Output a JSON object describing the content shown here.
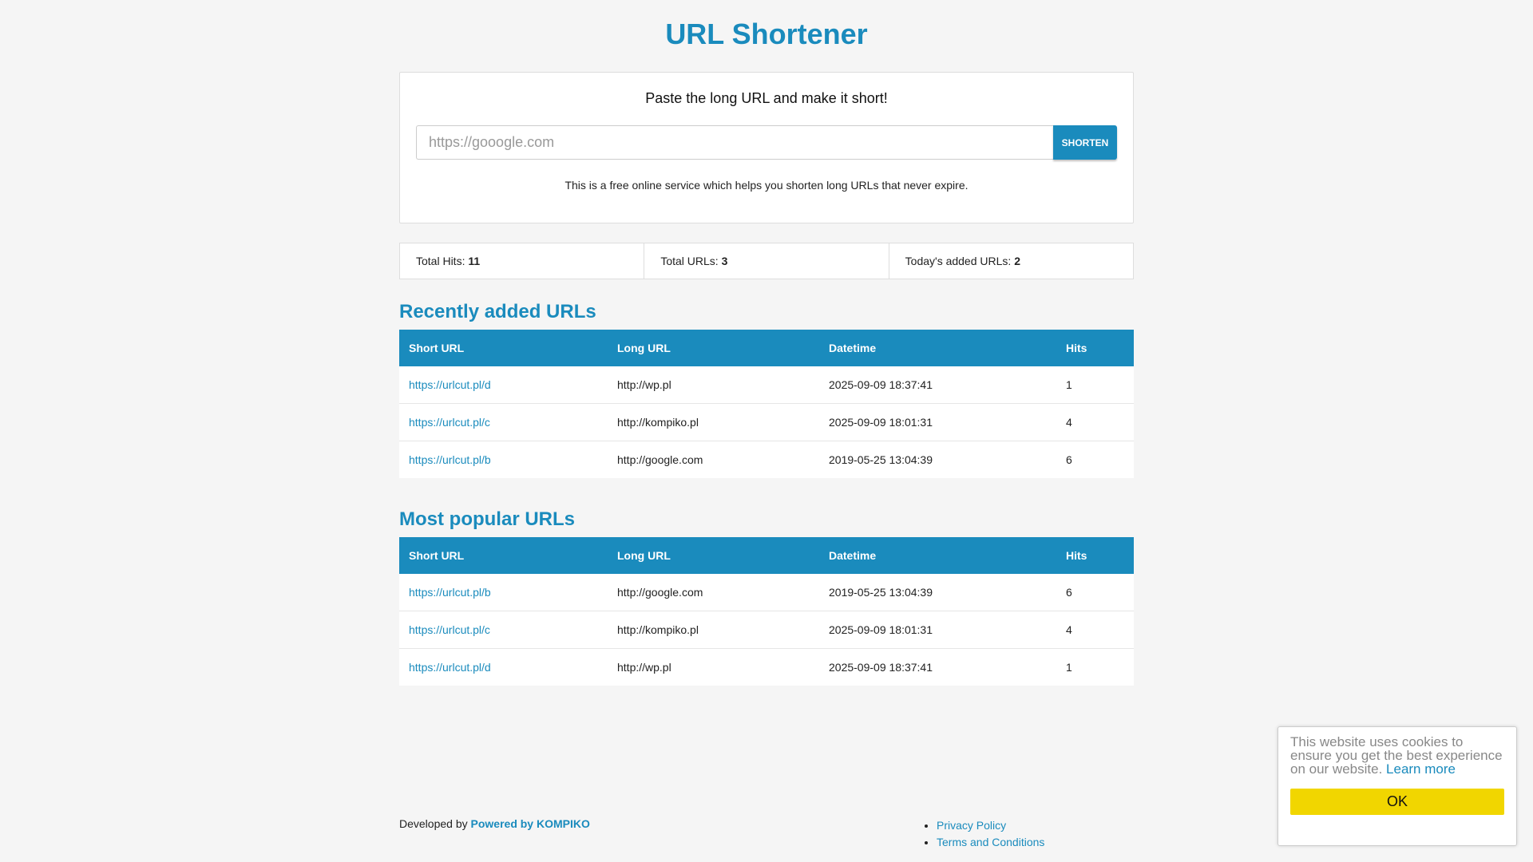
{
  "header": {
    "title": "URL Shortener"
  },
  "shortener": {
    "heading": "Paste the long URL and make it short!",
    "input_placeholder": "https://gooogle.com",
    "button_label": "SHORTEN",
    "info": "This is a free online service which helps you shorten long URLs that never expire."
  },
  "stats": {
    "total_hits_label": "Total Hits:",
    "total_hits_value": "11",
    "total_urls_label": "Total URLs:",
    "total_urls_value": "3",
    "today_label": "Today's added URLs:",
    "today_value": "2"
  },
  "recent": {
    "title": "Recently added URLs",
    "columns": [
      "Short URL",
      "Long URL",
      "Datetime",
      "Hits"
    ],
    "rows": [
      [
        "https://urlcut.pl/d",
        "http://wp.pl",
        "2025-09-09 18:37:41",
        "1"
      ],
      [
        "https://urlcut.pl/c",
        "http://kompiko.pl",
        "2025-09-09 18:01:31",
        "4"
      ],
      [
        "https://urlcut.pl/b",
        "http://google.com",
        "2019-05-25 13:04:39",
        "6"
      ]
    ]
  },
  "popular": {
    "title": "Most popular URLs",
    "columns": [
      "Short URL",
      "Long URL",
      "Datetime",
      "Hits"
    ],
    "rows": [
      [
        "https://urlcut.pl/b",
        "http://google.com",
        "2019-05-25 13:04:39",
        "6"
      ],
      [
        "https://urlcut.pl/c",
        "http://kompiko.pl",
        "2025-09-09 18:01:31",
        "4"
      ],
      [
        "https://urlcut.pl/d",
        "http://wp.pl",
        "2025-09-09 18:37:41",
        "1"
      ]
    ]
  },
  "footer": {
    "developed_by": "Developed by",
    "powered_by": "Powered by KOMPIKO",
    "links": [
      "Privacy Policy",
      "Terms and Conditions"
    ]
  },
  "cookie": {
    "message": "This website uses cookies to ensure you get the best experience on our website.",
    "learn_more": "Learn more",
    "ok_label": "OK"
  },
  "colors": {
    "accent": "#1a8bbd",
    "cookie_button": "#f1d600",
    "background": "#f5f5f5"
  }
}
